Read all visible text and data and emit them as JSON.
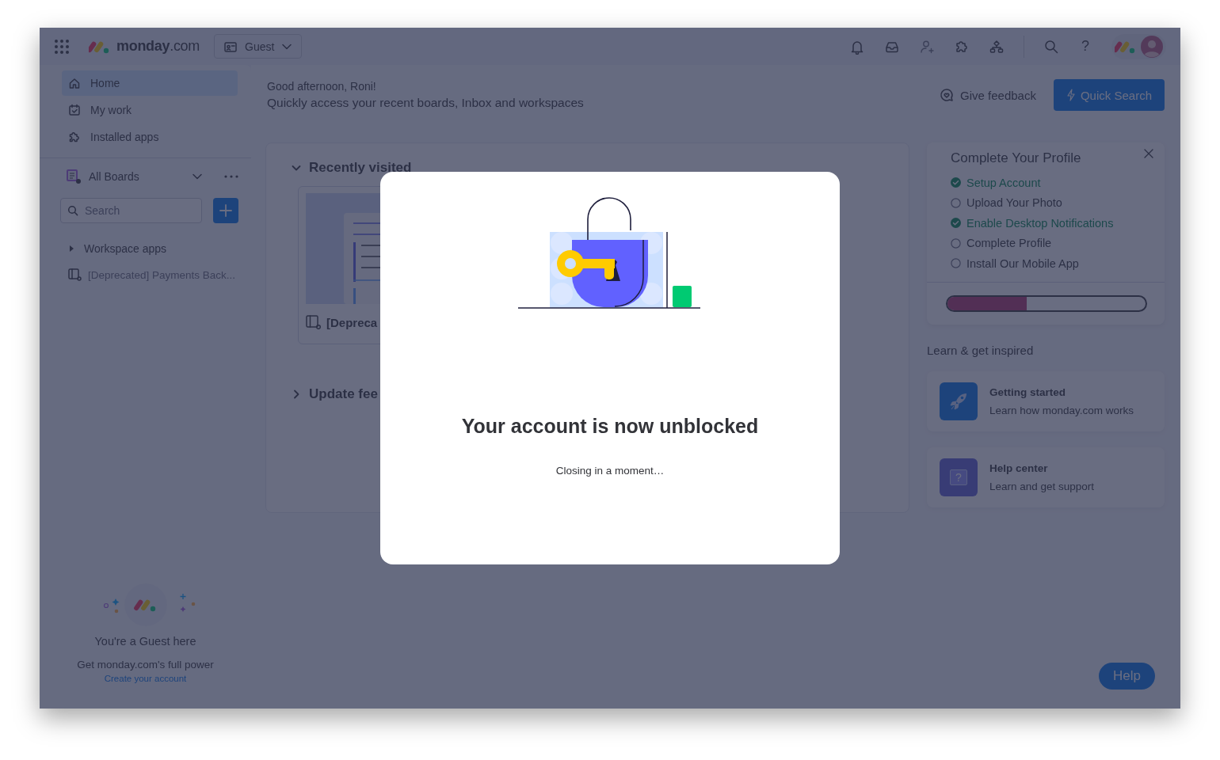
{
  "topbar": {
    "brand": "**monday**.com",
    "workspace": "Guest",
    "help_glyph": "?"
  },
  "sidebar": {
    "nav": [
      {
        "label": "Home",
        "selected": true
      },
      {
        "label": "My work",
        "selected": false
      },
      {
        "label": "Installed apps",
        "selected": false
      }
    ],
    "boards_selector": "All Boards",
    "search": {
      "placeholder": "Search"
    },
    "tree": [
      {
        "label": "Workspace apps",
        "expanded": false
      }
    ],
    "boards": [
      "[Deprecated] Payments Back..."
    ],
    "guest": {
      "title": "You're a Guest here",
      "text": "Get monday.com's full power",
      "link": "Create your account"
    }
  },
  "header": {
    "greeting": "Good afternoon, Roni!",
    "subtitle": "Quickly access your recent boards, Inbox and workspaces",
    "feedback": "Give feedback",
    "quick_search": "Quick Search"
  },
  "sections": [
    {
      "title": "Recently visited",
      "expanded": true,
      "cards": [
        {
          "title": "[Depreca"
        }
      ]
    },
    {
      "title": "Update fee",
      "expanded": false
    }
  ],
  "profile": {
    "title": "Complete Your Profile",
    "tasks": [
      {
        "label": "Setup Account",
        "done": true
      },
      {
        "label": "Upload Your Photo",
        "done": false
      },
      {
        "label": "Enable Desktop Notifications",
        "done": true
      },
      {
        "label": "Complete Profile",
        "done": false
      },
      {
        "label": "Install Our Mobile App",
        "done": false
      }
    ],
    "level": 0.4
  },
  "learn": {
    "title": "Learn & get inspired",
    "cards": [
      {
        "kind": "rocket",
        "title": "Getting started",
        "text": "Learn how monday.com works"
      },
      {
        "kind": "help",
        "glyph": "?",
        "title": "Help center",
        "text": "Learn and get support"
      }
    ]
  },
  "help_button": "Help",
  "modal": {
    "title": "Your account is now unblocked",
    "text": "Closing in a moment…"
  }
}
